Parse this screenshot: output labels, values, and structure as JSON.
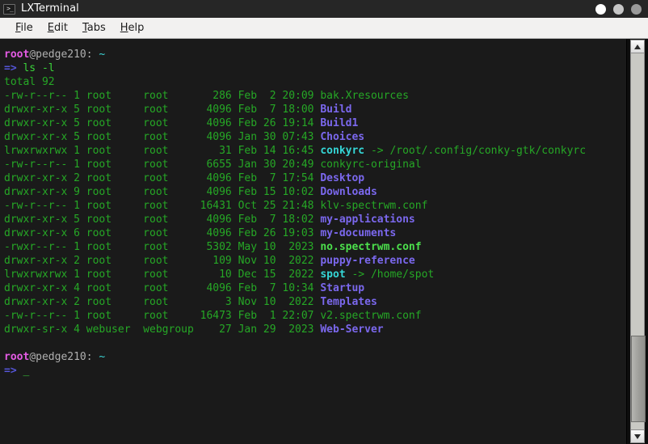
{
  "window": {
    "title": "LXTerminal",
    "icon": "terminal-icon",
    "icon_glyph": ">_",
    "buttons": [
      {
        "name": "minimize-button",
        "color": "#ffffff"
      },
      {
        "name": "maximize-button",
        "color": "#c6c6c6"
      },
      {
        "name": "close-button",
        "color": "#9a9a9a"
      }
    ]
  },
  "menubar": {
    "items": [
      {
        "name": "menu-file",
        "accel": "F",
        "rest": "ile"
      },
      {
        "name": "menu-edit",
        "accel": "E",
        "rest": "dit"
      },
      {
        "name": "menu-tabs",
        "accel": "T",
        "rest": "abs"
      },
      {
        "name": "menu-help",
        "accel": "H",
        "rest": "elp"
      }
    ]
  },
  "terminal": {
    "colors": {
      "background": "#1a1a1a",
      "foreground": "#26a826",
      "user": "#e45be4",
      "host": "#b0b0b0",
      "path": "#3bd4d4",
      "prompt_arrow": "#5555d8",
      "command": "#3bd43b",
      "directory": "#7b68ee",
      "symlink": "#35d6d6",
      "executable": "#4ce04c"
    },
    "prompt": {
      "user": "root",
      "host_sep": "@pedge210: ",
      "path": "~",
      "arrow": "=>"
    },
    "command": "ls -l",
    "total_line": "total 92",
    "listing": [
      {
        "perms": "-rw-r--r--",
        "links": "1",
        "owner": "root",
        "group": "root",
        "size": "286",
        "month": "Feb",
        "day": "2",
        "time": "20:09",
        "name": "bak.Xresources",
        "type": "file",
        "target": ""
      },
      {
        "perms": "drwxr-xr-x",
        "links": "5",
        "owner": "root",
        "group": "root",
        "size": "4096",
        "month": "Feb",
        "day": "7",
        "time": "18:00",
        "name": "Build",
        "type": "dir",
        "target": ""
      },
      {
        "perms": "drwxr-xr-x",
        "links": "5",
        "owner": "root",
        "group": "root",
        "size": "4096",
        "month": "Feb",
        "day": "26",
        "time": "19:14",
        "name": "Build1",
        "type": "dir",
        "target": ""
      },
      {
        "perms": "drwxr-xr-x",
        "links": "5",
        "owner": "root",
        "group": "root",
        "size": "4096",
        "month": "Jan",
        "day": "30",
        "time": "07:43",
        "name": "Choices",
        "type": "dir",
        "target": ""
      },
      {
        "perms": "lrwxrwxrwx",
        "links": "1",
        "owner": "root",
        "group": "root",
        "size": "31",
        "month": "Feb",
        "day": "14",
        "time": "16:45",
        "name": "conkyrc",
        "type": "link",
        "target": "/root/.config/conky-gtk/conkyrc"
      },
      {
        "perms": "-rw-r--r--",
        "links": "1",
        "owner": "root",
        "group": "root",
        "size": "6655",
        "month": "Jan",
        "day": "30",
        "time": "20:49",
        "name": "conkyrc-original",
        "type": "file",
        "target": ""
      },
      {
        "perms": "drwxr-xr-x",
        "links": "2",
        "owner": "root",
        "group": "root",
        "size": "4096",
        "month": "Feb",
        "day": "7",
        "time": "17:54",
        "name": "Desktop",
        "type": "dir",
        "target": ""
      },
      {
        "perms": "drwxr-xr-x",
        "links": "9",
        "owner": "root",
        "group": "root",
        "size": "4096",
        "month": "Feb",
        "day": "15",
        "time": "10:02",
        "name": "Downloads",
        "type": "dir",
        "target": ""
      },
      {
        "perms": "-rw-r--r--",
        "links": "1",
        "owner": "root",
        "group": "root",
        "size": "16431",
        "month": "Oct",
        "day": "25",
        "time": "21:48",
        "name": "klv-spectrwm.conf",
        "type": "file",
        "target": ""
      },
      {
        "perms": "drwxr-xr-x",
        "links": "5",
        "owner": "root",
        "group": "root",
        "size": "4096",
        "month": "Feb",
        "day": "7",
        "time": "18:02",
        "name": "my-applications",
        "type": "dir",
        "target": ""
      },
      {
        "perms": "drwxr-xr-x",
        "links": "6",
        "owner": "root",
        "group": "root",
        "size": "4096",
        "month": "Feb",
        "day": "26",
        "time": "19:03",
        "name": "my-documents",
        "type": "dir",
        "target": ""
      },
      {
        "perms": "-rwxr--r--",
        "links": "1",
        "owner": "root",
        "group": "root",
        "size": "5302",
        "month": "May",
        "day": "10",
        "time": "2023",
        "name": "no.spectrwm.conf",
        "type": "exec",
        "target": ""
      },
      {
        "perms": "drwxr-xr-x",
        "links": "2",
        "owner": "root",
        "group": "root",
        "size": "109",
        "month": "Nov",
        "day": "10",
        "time": "2022",
        "name": "puppy-reference",
        "type": "dir",
        "target": ""
      },
      {
        "perms": "lrwxrwxrwx",
        "links": "1",
        "owner": "root",
        "group": "root",
        "size": "10",
        "month": "Dec",
        "day": "15",
        "time": "2022",
        "name": "spot",
        "type": "link",
        "target": "/home/spot"
      },
      {
        "perms": "drwxr-xr-x",
        "links": "4",
        "owner": "root",
        "group": "root",
        "size": "4096",
        "month": "Feb",
        "day": "7",
        "time": "10:34",
        "name": "Startup",
        "type": "dir",
        "target": ""
      },
      {
        "perms": "drwxr-xr-x",
        "links": "2",
        "owner": "root",
        "group": "root",
        "size": "3",
        "month": "Nov",
        "day": "10",
        "time": "2022",
        "name": "Templates",
        "type": "dir",
        "target": ""
      },
      {
        "perms": "-rw-r--r--",
        "links": "1",
        "owner": "root",
        "group": "root",
        "size": "16473",
        "month": "Feb",
        "day": "1",
        "time": "22:07",
        "name": "v2.spectrwm.conf",
        "type": "file",
        "target": ""
      },
      {
        "perms": "drwxr-sr-x",
        "links": "4",
        "owner": "webuser",
        "group": "webgroup",
        "size": "27",
        "month": "Jan",
        "day": "29",
        "time": "2023",
        "name": "Web-Server",
        "type": "dir",
        "target": ""
      }
    ],
    "cursor": "_"
  },
  "scrollbar": {
    "up_arrow": "scroll-up",
    "down_arrow": "scroll-down",
    "thumb_top_pct": 75,
    "thumb_height_pct": 23
  }
}
